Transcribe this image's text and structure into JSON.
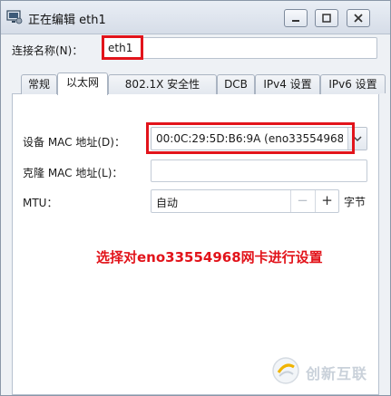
{
  "window": {
    "title": "正在编辑 eth1",
    "icon": "network-settings-icon"
  },
  "connection": {
    "label": "连接名称(N)：",
    "value": "eth1"
  },
  "tabs": [
    {
      "label": "常规",
      "active": false
    },
    {
      "label": "以太网",
      "active": true
    },
    {
      "label": "802.1X 安全性",
      "active": false
    },
    {
      "label": "DCB",
      "active": false
    },
    {
      "label": "IPv4 设置",
      "active": false
    },
    {
      "label": "IPv6 设置",
      "active": false
    }
  ],
  "ethernet": {
    "device_mac_label": "设备 MAC 地址(D)：",
    "device_mac_value": "00:0C:29:5D:B6:9A (eno33554968)",
    "cloned_mac_label": "克隆 MAC 地址(L)：",
    "cloned_mac_value": "",
    "mtu_label": "MTU：",
    "mtu_value": "自动",
    "mtu_unit": "字节"
  },
  "annotation": "选择对eno33554968网卡进行设置",
  "watermark": {
    "text": "创新互联"
  },
  "colors": {
    "highlight": "#e2141b",
    "titlebar": "#dfe5ee"
  }
}
